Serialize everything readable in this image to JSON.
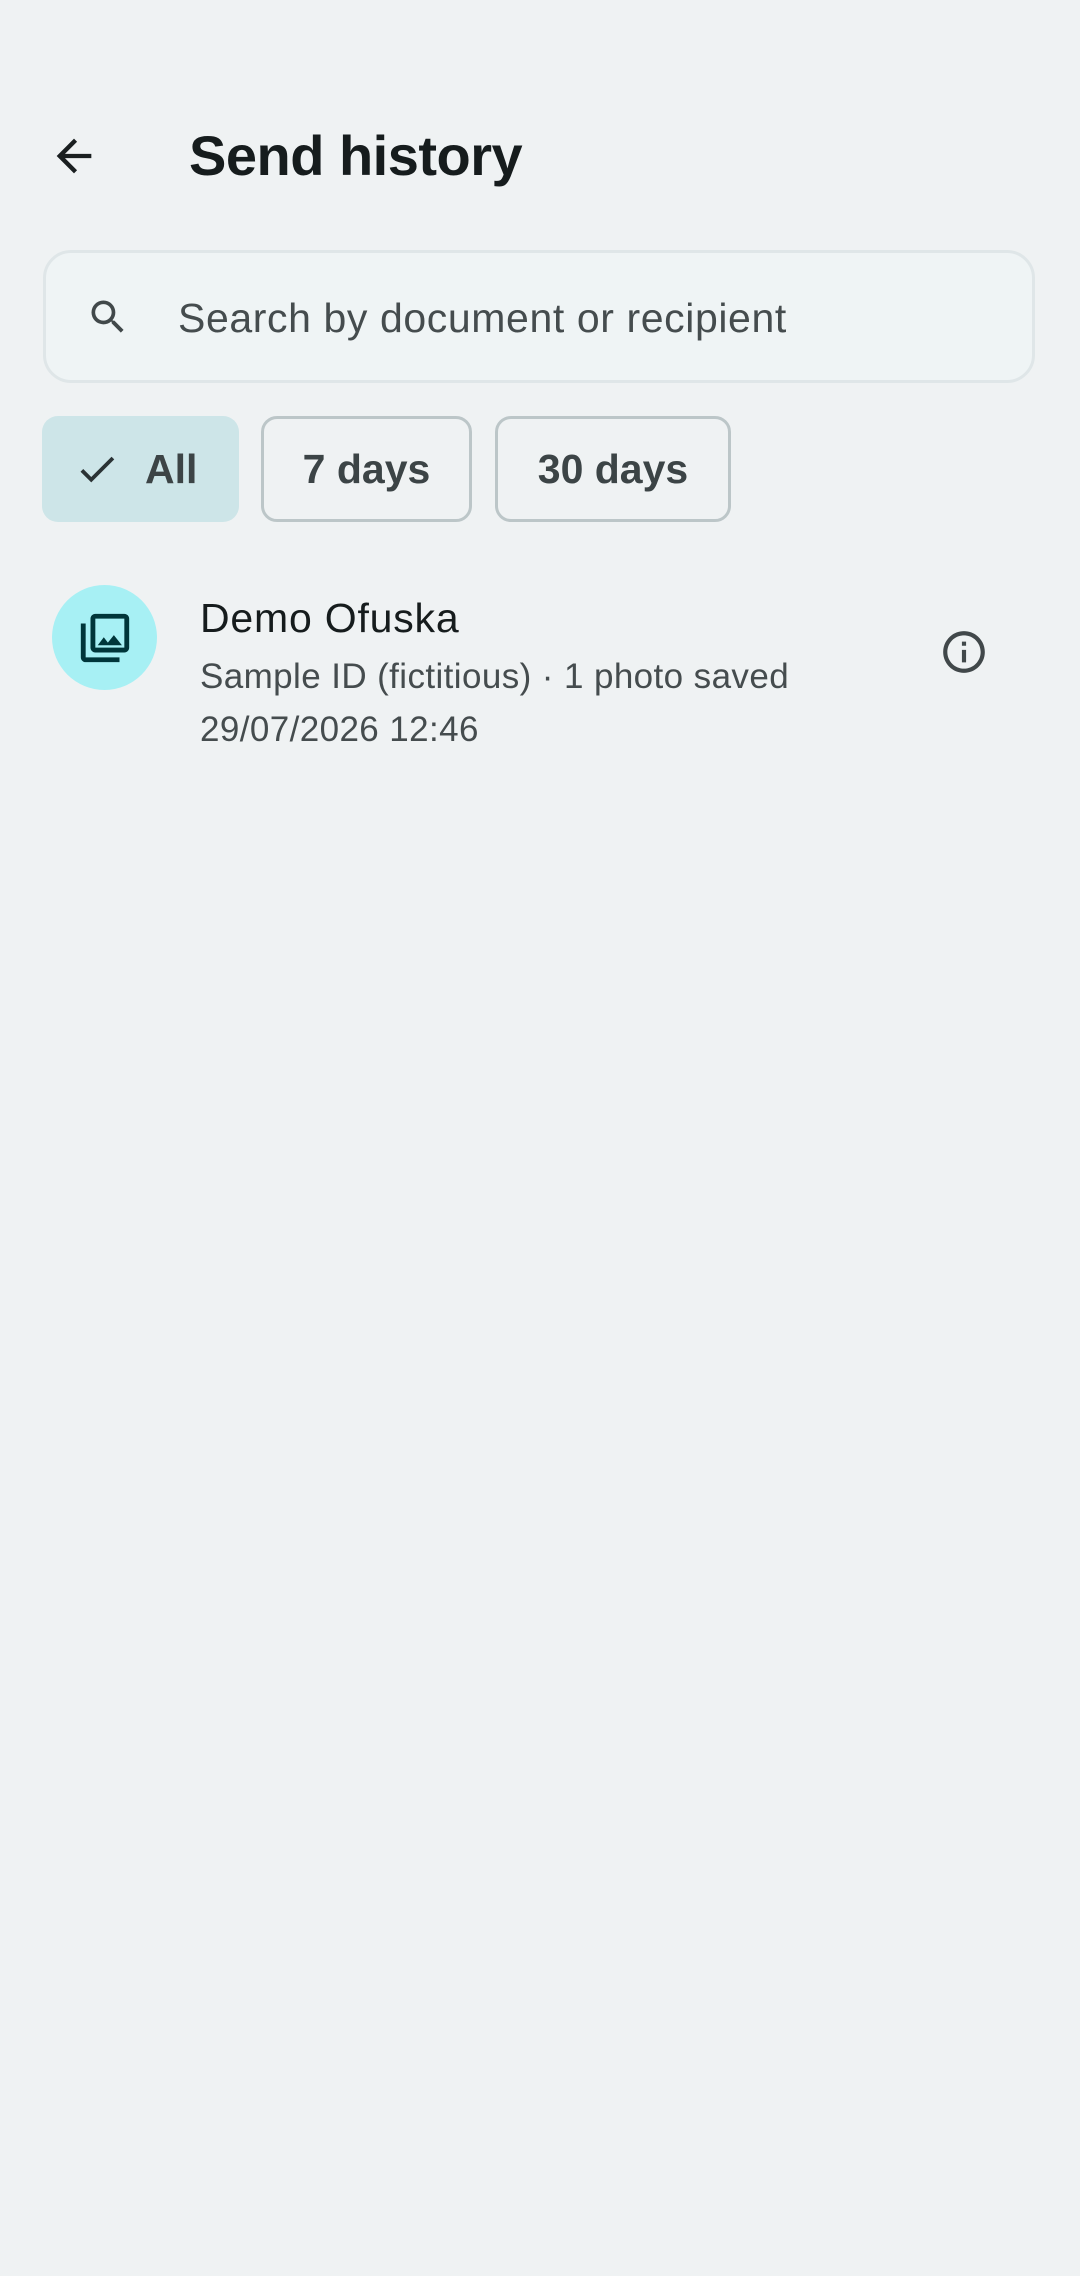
{
  "header": {
    "back_icon": "arrow-back-icon",
    "title": "Send history"
  },
  "search": {
    "icon": "search-icon",
    "placeholder": "Search by document or recipient",
    "value": ""
  },
  "filters": {
    "selected": "All",
    "chips": [
      {
        "label": "All",
        "selected": true,
        "icon": "check-icon"
      },
      {
        "label": "7 days",
        "selected": false
      },
      {
        "label": "30 days",
        "selected": false
      }
    ]
  },
  "history": {
    "items": [
      {
        "icon": "photo-library-icon",
        "name": "Demo Ofuska",
        "subtitle": "Sample ID (fictitious) · 1 photo saved",
        "date": "29/07/2026 12:46",
        "action_icon": "info-icon"
      }
    ]
  },
  "colors": {
    "background": "#eff2f3",
    "chip_selected": "#cde5e8",
    "avatar_bg": "#a7f0f4",
    "avatar_icon": "#00363a"
  }
}
